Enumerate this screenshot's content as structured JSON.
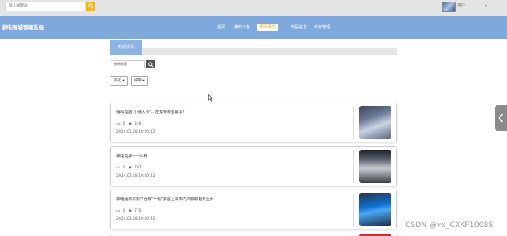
{
  "topbar": {
    "search_placeholder": "输入关键词",
    "user_name": "用户"
  },
  "nav": {
    "brand": "家电商城管理系统",
    "items": [
      {
        "label": "首页"
      },
      {
        "label": "通知公告"
      },
      {
        "label": "新闻资讯",
        "active": true
      },
      {
        "label": "商品信息"
      },
      {
        "label": "商城管理"
      }
    ]
  },
  "section": {
    "title": "新闻资讯",
    "filter_placeholder": "新闻标题",
    "filter_label": "筛选",
    "sort_label": "排序"
  },
  "articles": [
    {
      "title": "推叫电脑\"小纸大桥\"，还需要哪些解法？",
      "likes": "0",
      "views": "146",
      "date": "2024.03.28 10:00:42"
    },
    {
      "title": "家电电解——冰箱",
      "likes": "0",
      "views": "797",
      "date": "2024.03.28 10:00:42"
    },
    {
      "title": "家电推新采购平台联\"牛犊\"家居上海市内外家家电专业办",
      "likes": "0",
      "views": "770",
      "date": "2024.03.28 10:00:42"
    }
  ],
  "watermark": "CSDN @vx_CXKF10088",
  "colors": {
    "nav_bg": "#7fa9dd",
    "accent": "#f3b51b",
    "active_text": "#f0a31a"
  }
}
